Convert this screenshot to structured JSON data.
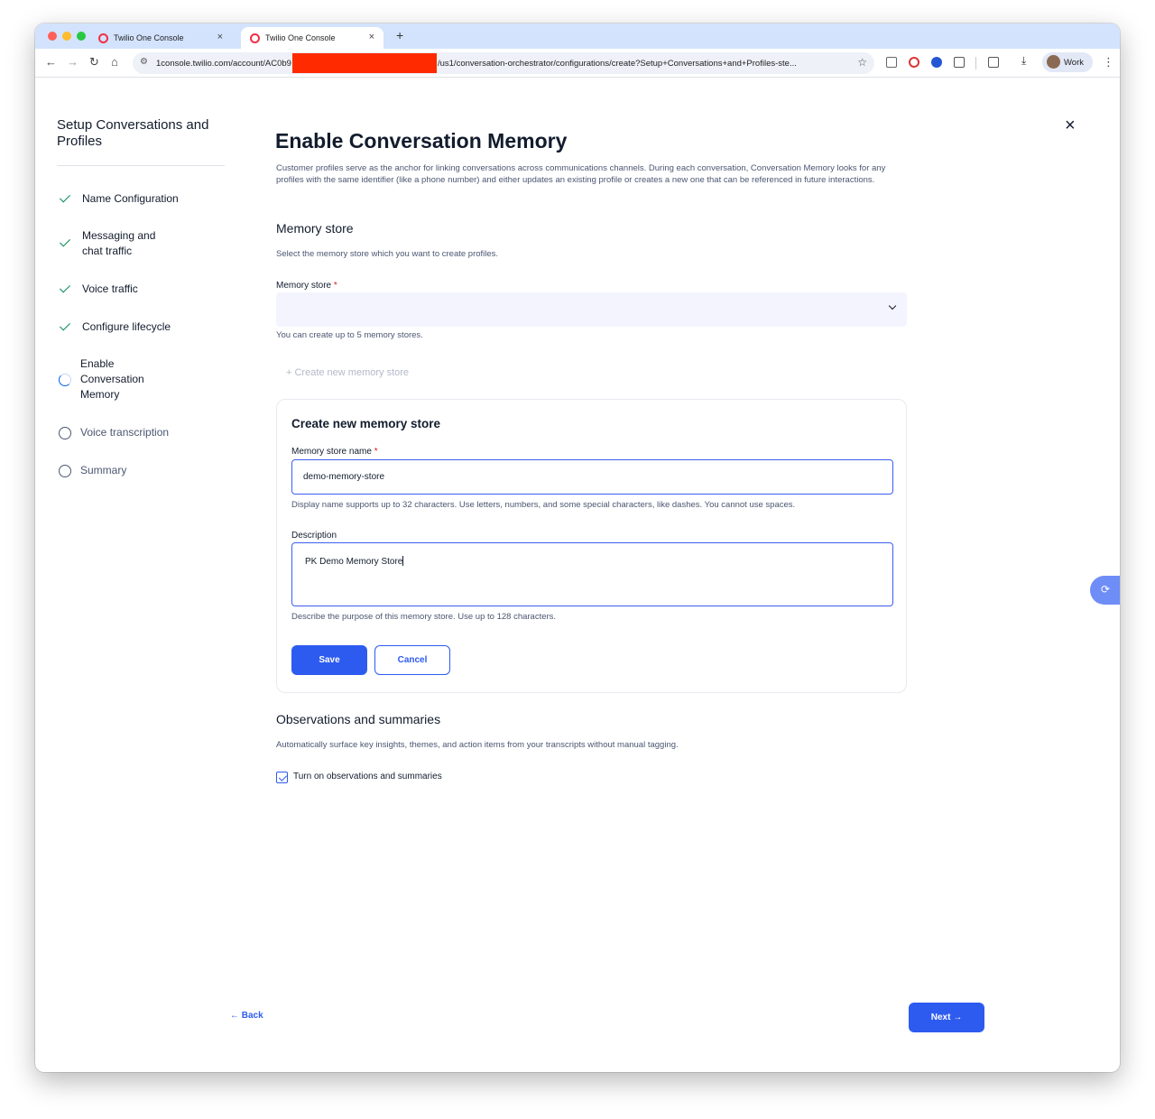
{
  "browser": {
    "tabs": [
      {
        "title": "Twilio One Console",
        "active": false
      },
      {
        "title": "Twilio One Console",
        "active": true
      }
    ],
    "new_tab": "+",
    "url_start": "1console.twilio.com/account/AC0b9",
    "url_end": "/us1/conversation-orchestrator/configurations/create?Setup+Conversations+and+Profiles-ste...",
    "profile_label": "Work",
    "icons": {
      "back": "←",
      "forward": "→",
      "reload": "↻",
      "home": "⌂",
      "bookmark": "☆",
      "menu": "⋮",
      "tab_close": "×",
      "download": "⤓",
      "tune": "⚙"
    }
  },
  "rail": {
    "title": "Setup Conversations and Profiles",
    "steps": [
      {
        "label": "Name Configuration",
        "state": "done"
      },
      {
        "label": "Messaging and chat traffic",
        "state": "done"
      },
      {
        "label": "Voice traffic",
        "state": "done"
      },
      {
        "label": "Configure lifecycle",
        "state": "done"
      },
      {
        "label": "Enable Conversation Memory",
        "state": "current"
      },
      {
        "label": "Voice transcription",
        "state": "pending"
      },
      {
        "label": "Summary",
        "state": "pending"
      }
    ]
  },
  "page": {
    "title": "Enable Conversation Memory",
    "intro": "Customer profiles serve as the anchor for linking conversations across communications channels. During each conversation, Conversation Memory looks for any profiles with the same identifier (like a phone number) and either updates an existing profile or creates a new one that can be referenced in future interactions.",
    "close": "×"
  },
  "memory_store": {
    "heading": "Memory store",
    "description": "Select the memory store which you want to create profiles.",
    "label": "Memory store",
    "required": "*",
    "selected": "",
    "hint": "You can create up to 5 memory stores.",
    "create_link": "+ Create new memory store"
  },
  "create_card": {
    "title": "Create new memory store",
    "name_label": "Memory store name",
    "name_required": "*",
    "name_value": "demo-memory-store",
    "name_hint": "Display name supports up to 32 characters. Use letters, numbers, and some special characters, like dashes. You cannot use spaces.",
    "desc_label": "Description",
    "desc_value": "PK Demo Memory Store",
    "desc_hint": "Describe the purpose of this memory store. Use up to 128 characters.",
    "save_label": "Save",
    "cancel_label": "Cancel"
  },
  "observations": {
    "heading": "Observations and summaries",
    "description": "Automatically surface key insights, themes, and action items from your transcripts without manual tagging.",
    "checkbox_label": "Turn on observations and summaries",
    "checked": true
  },
  "footer": {
    "back_label": "← Back",
    "next_label": "Next →"
  },
  "colors": {
    "primary": "#2d5bf0",
    "success": "#0a8a52",
    "required": "#d61f1f",
    "redaction": "#ff2a00"
  }
}
